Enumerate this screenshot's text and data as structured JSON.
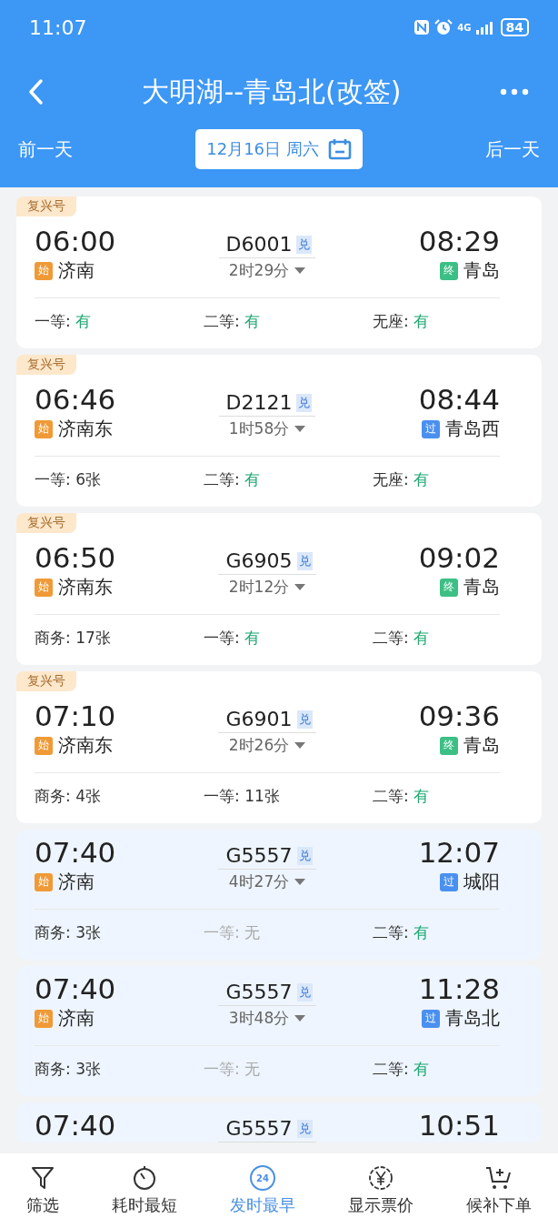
{
  "status_bar": {
    "time": "11:07",
    "network": "4G",
    "battery": "84"
  },
  "header": {
    "title": "大明湖--青岛北(改签)",
    "prev_day": "前一天",
    "date": "12月16日 周六",
    "next_day": "后一天"
  },
  "trains": [
    {
      "tag": "复兴号",
      "tinted": false,
      "depart": "06:00",
      "from": {
        "badge": "始",
        "kind": "start",
        "name": "济南"
      },
      "number": "D6001",
      "exchange": "兑",
      "duration": "2时29分",
      "arrive": "08:29",
      "to": {
        "badge": "终",
        "kind": "end",
        "name": "青岛"
      },
      "seats": [
        {
          "label": "一等:",
          "value": "有",
          "kind": "plenty"
        },
        {
          "label": "二等:",
          "value": "有",
          "kind": "plenty"
        },
        {
          "label": "无座:",
          "value": "有",
          "kind": "plenty"
        }
      ]
    },
    {
      "tag": "复兴号",
      "tinted": false,
      "depart": "06:46",
      "from": {
        "badge": "始",
        "kind": "start",
        "name": "济南东"
      },
      "number": "D2121",
      "exchange": "兑",
      "duration": "1时58分",
      "arrive": "08:44",
      "to": {
        "badge": "过",
        "kind": "pass",
        "name": "青岛西"
      },
      "seats": [
        {
          "label": "一等:",
          "value": "6张",
          "kind": "count"
        },
        {
          "label": "二等:",
          "value": "有",
          "kind": "plenty"
        },
        {
          "label": "无座:",
          "value": "有",
          "kind": "plenty"
        }
      ]
    },
    {
      "tag": "复兴号",
      "tinted": false,
      "depart": "06:50",
      "from": {
        "badge": "始",
        "kind": "start",
        "name": "济南东"
      },
      "number": "G6905",
      "exchange": "兑",
      "duration": "2时12分",
      "arrive": "09:02",
      "to": {
        "badge": "终",
        "kind": "end",
        "name": "青岛"
      },
      "seats": [
        {
          "label": "商务:",
          "value": "17张",
          "kind": "count"
        },
        {
          "label": "一等:",
          "value": "有",
          "kind": "plenty"
        },
        {
          "label": "二等:",
          "value": "有",
          "kind": "plenty"
        }
      ]
    },
    {
      "tag": "复兴号",
      "tinted": false,
      "depart": "07:10",
      "from": {
        "badge": "始",
        "kind": "start",
        "name": "济南东"
      },
      "number": "G6901",
      "exchange": "兑",
      "duration": "2时26分",
      "arrive": "09:36",
      "to": {
        "badge": "终",
        "kind": "end",
        "name": "青岛"
      },
      "seats": [
        {
          "label": "商务:",
          "value": "4张",
          "kind": "count"
        },
        {
          "label": "一等:",
          "value": "11张",
          "kind": "count"
        },
        {
          "label": "二等:",
          "value": "有",
          "kind": "plenty"
        }
      ]
    },
    {
      "tinted": true,
      "depart": "07:40",
      "from": {
        "badge": "始",
        "kind": "start",
        "name": "济南"
      },
      "number": "G5557",
      "exchange": "兑",
      "duration": "4时27分",
      "arrive": "12:07",
      "to": {
        "badge": "过",
        "kind": "pass",
        "name": "城阳"
      },
      "seats": [
        {
          "label": "商务:",
          "value": "3张",
          "kind": "count"
        },
        {
          "label": "一等:",
          "value": "无",
          "kind": "none"
        },
        {
          "label": "二等:",
          "value": "有",
          "kind": "plenty"
        }
      ]
    },
    {
      "tinted": true,
      "depart": "07:40",
      "from": {
        "badge": "始",
        "kind": "start",
        "name": "济南"
      },
      "number": "G5557",
      "exchange": "兑",
      "duration": "3时48分",
      "arrive": "11:28",
      "to": {
        "badge": "过",
        "kind": "pass",
        "name": "青岛北"
      },
      "seats": [
        {
          "label": "商务:",
          "value": "3张",
          "kind": "count"
        },
        {
          "label": "一等:",
          "value": "无",
          "kind": "none"
        },
        {
          "label": "二等:",
          "value": "有",
          "kind": "plenty"
        }
      ]
    },
    {
      "tinted": true,
      "depart": "07:40",
      "number": "G5557",
      "exchange": "兑",
      "arrive": "10:51"
    }
  ],
  "bottom_nav": [
    {
      "label": "筛选",
      "kind": "filter",
      "selected": false
    },
    {
      "label": "耗时最短",
      "kind": "timer",
      "selected": false
    },
    {
      "label": "发时最早",
      "kind": "clock",
      "icon_text": "24",
      "selected": true
    },
    {
      "label": "显示票价",
      "kind": "price",
      "selected": false
    },
    {
      "label": "候补下单",
      "kind": "cart",
      "selected": false
    }
  ]
}
